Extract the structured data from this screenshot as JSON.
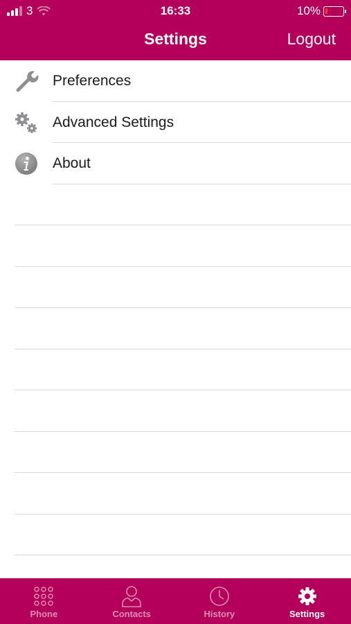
{
  "status": {
    "carrier": "3",
    "time": "16:33",
    "battery": "10%"
  },
  "nav": {
    "title": "Settings",
    "logout_label": "Logout"
  },
  "menu": [
    {
      "label": "Preferences",
      "icon": "wrench-icon"
    },
    {
      "label": "Advanced Settings",
      "icon": "gears-icon"
    },
    {
      "label": "About",
      "icon": "info-icon"
    }
  ],
  "tabs": [
    {
      "label": "Phone",
      "icon": "keypad-icon",
      "active": false
    },
    {
      "label": "Contacts",
      "icon": "person-icon",
      "active": false
    },
    {
      "label": "History",
      "icon": "clock-icon",
      "active": false
    },
    {
      "label": "Settings",
      "icon": "gear-icon",
      "active": true
    }
  ],
  "colors": {
    "brand": "#b3005a",
    "separator": "#d9d9d9",
    "icon_gray": "#8e8e93"
  }
}
